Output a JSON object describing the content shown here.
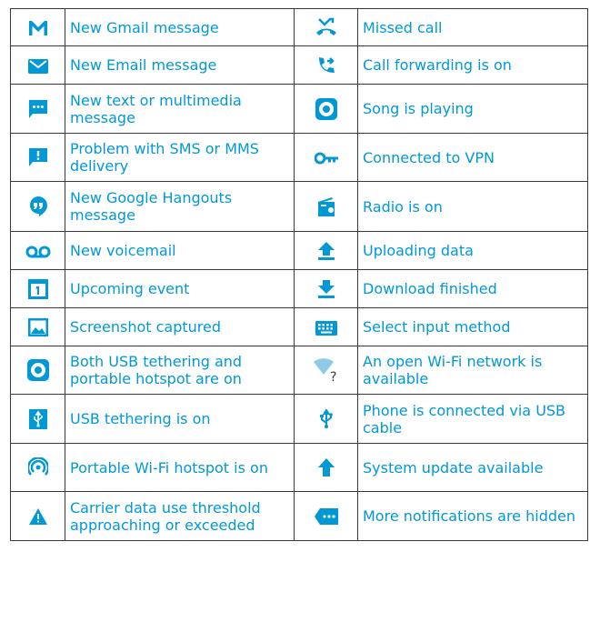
{
  "colors": {
    "accent": "#0099d6",
    "border": "#3a3a3a",
    "background": "#ffffff"
  },
  "rows": [
    {
      "left": {
        "icon": "gmail-icon",
        "label": "New Gmail message"
      },
      "right": {
        "icon": "missed-call-icon",
        "label": "Missed call"
      }
    },
    {
      "left": {
        "icon": "email-icon",
        "label": "New Email message"
      },
      "right": {
        "icon": "call-forward-icon",
        "label": "Call forwarding is on"
      }
    },
    {
      "left": {
        "icon": "text-message-icon",
        "label": "New text or multimedia message"
      },
      "right": {
        "icon": "song-playing-icon",
        "label": "Song is playing"
      }
    },
    {
      "left": {
        "icon": "sms-problem-icon",
        "label": "Problem with SMS or MMS delivery"
      },
      "right": {
        "icon": "vpn-key-icon",
        "label": "Connected to VPN"
      }
    },
    {
      "left": {
        "icon": "hangouts-icon",
        "label": "New Google Hangouts message"
      },
      "right": {
        "icon": "radio-icon",
        "label": "Radio is on"
      }
    },
    {
      "left": {
        "icon": "voicemail-icon",
        "label": "New voicemail"
      },
      "right": {
        "icon": "upload-icon",
        "label": "Uploading data"
      }
    },
    {
      "left": {
        "icon": "calendar-icon",
        "label": "Upcoming event"
      },
      "right": {
        "icon": "download-icon",
        "label": "Download finished"
      }
    },
    {
      "left": {
        "icon": "screenshot-icon",
        "label": "Screenshot captured"
      },
      "right": {
        "icon": "keyboard-icon",
        "label": "Select input method"
      }
    },
    {
      "left": {
        "icon": "tethering-hotspot-icon",
        "label": "Both USB tethering and portable hotspot are on"
      },
      "right": {
        "icon": "open-wifi-icon",
        "label": "An open Wi-Fi network is available"
      }
    },
    {
      "left": {
        "icon": "usb-tethering-icon",
        "label": "USB tethering is on"
      },
      "right": {
        "icon": "usb-icon",
        "label": "Phone is connected via USB cable"
      }
    },
    {
      "left": {
        "icon": "hotspot-icon",
        "label": "Portable Wi-Fi hotspot is on"
      },
      "right": {
        "icon": "system-update-icon",
        "label": "System update available"
      }
    },
    {
      "left": {
        "icon": "warning-icon",
        "label": "Carrier data use threshold approaching or exceeded"
      },
      "right": {
        "icon": "more-notifications-icon",
        "label": "More notifications are hidden"
      }
    }
  ]
}
